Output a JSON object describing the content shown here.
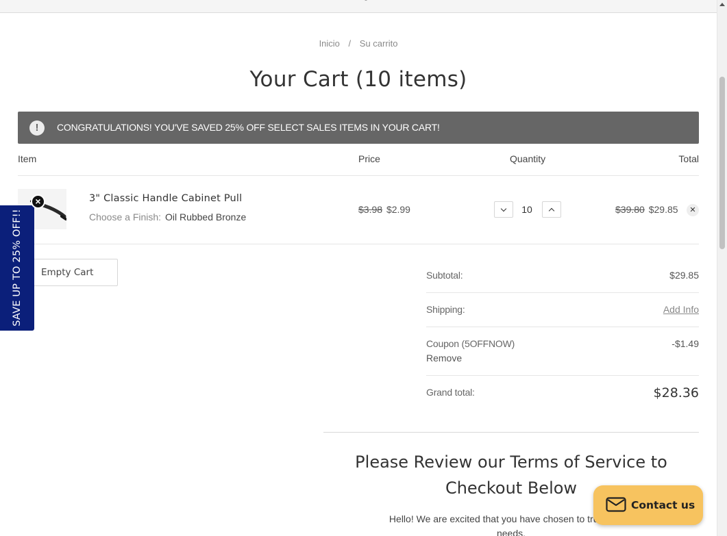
{
  "breadcrumb": {
    "home": "Inicio",
    "separator": "/",
    "current": "Su carrito"
  },
  "page": {
    "title": "Your Cart (10 items)"
  },
  "alert": {
    "icon": "exclamation-circle-icon",
    "text": "CONGRATULATIONS! YOU'VE SAVED 25% OFF SELECT SALES ITEMS IN YOUR CART!"
  },
  "table": {
    "headers": {
      "item": "Item",
      "price": "Price",
      "quantity": "Quantity",
      "total": "Total"
    }
  },
  "cart_items": [
    {
      "name": "3\" Classic Handle Cabinet Pull",
      "finish_label": "Choose a Finish:",
      "finish_value": "Oil Rubbed Bronze",
      "price_old": "$3.98",
      "price_new": "$2.99",
      "quantity": "10",
      "total_old": "$39.80",
      "total_new": "$29.85"
    }
  ],
  "actions": {
    "empty_cart": "Empty Cart"
  },
  "side_tab": {
    "label": "SAVE UP TO 25% OFF!!"
  },
  "summary": {
    "subtotal_label": "Subtotal:",
    "subtotal_value": "$29.85",
    "shipping_label": "Shipping:",
    "shipping_link": "Add Info",
    "coupon_label": "Coupon (5OFFNOW)",
    "coupon_value": "-$1.49",
    "coupon_remove": "Remove",
    "grand_total_label": "Grand total:",
    "grand_total_value": "$28.36"
  },
  "terms": {
    "title": "Please Review our Terms of Service to Checkout Below",
    "body_line1": "Hello! We are excited that you have chosen to trust us wit",
    "body_line2": "needs."
  },
  "contact": {
    "label": "Contact us",
    "icon": "envelope-icon"
  },
  "colors": {
    "alert_bg": "#666666",
    "side_tab_bg": "#0b1f7a",
    "contact_bg": "#f7c35f"
  }
}
